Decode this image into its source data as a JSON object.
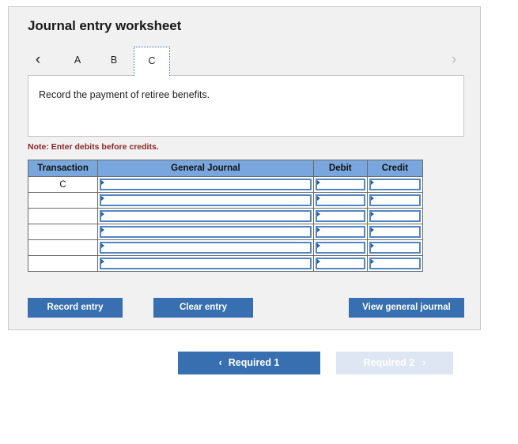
{
  "panel": {
    "title": "Journal entry worksheet"
  },
  "tabs": {
    "prev_icon": "chevron-left-icon",
    "next_icon": "chevron-right-icon",
    "prev_glyph": "‹",
    "next_glyph": "›",
    "items": [
      {
        "label": "A",
        "active": false
      },
      {
        "label": "B",
        "active": false
      },
      {
        "label": "C",
        "active": true
      }
    ]
  },
  "description": {
    "text": "Record the payment of retiree benefits."
  },
  "note": {
    "text": "Note: Enter debits before credits."
  },
  "table": {
    "headers": [
      "Transaction",
      "General Journal",
      "Debit",
      "Credit"
    ],
    "rows": [
      {
        "transaction": "C",
        "general_journal": "",
        "debit": "",
        "credit": ""
      },
      {
        "transaction": "",
        "general_journal": "",
        "debit": "",
        "credit": ""
      },
      {
        "transaction": "",
        "general_journal": "",
        "debit": "",
        "credit": ""
      },
      {
        "transaction": "",
        "general_journal": "",
        "debit": "",
        "credit": ""
      },
      {
        "transaction": "",
        "general_journal": "",
        "debit": "",
        "credit": ""
      },
      {
        "transaction": "",
        "general_journal": "",
        "debit": "",
        "credit": ""
      }
    ]
  },
  "actions": {
    "record_label": "Record entry",
    "clear_label": "Clear entry",
    "view_label": "View general journal"
  },
  "footer_nav": {
    "prev_label": "Required 1",
    "next_label": "Required 2",
    "prev_glyph": "‹",
    "next_glyph": "›"
  },
  "colors": {
    "accent": "#376fb1",
    "header_fill": "#79a7dd",
    "note": "#8b2525",
    "panel_bg": "#f1f1f1",
    "disabled_nav": "#dde6f2"
  }
}
